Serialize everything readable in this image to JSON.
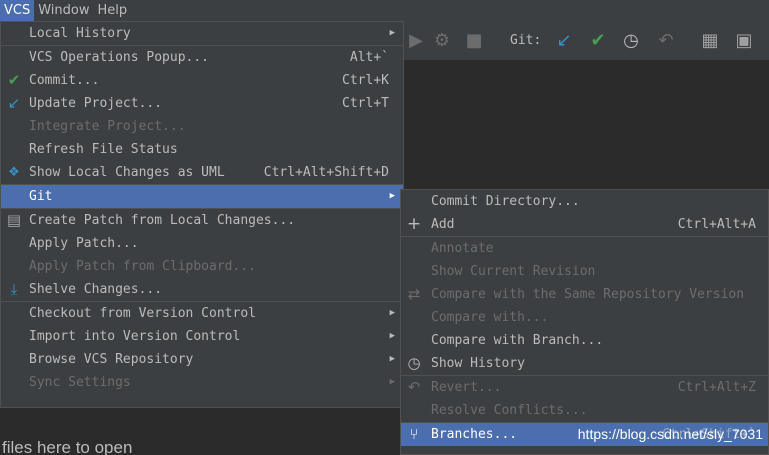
{
  "menubar": {
    "items": [
      {
        "label": "VCS"
      },
      {
        "label": "Window"
      },
      {
        "label": "Help"
      }
    ]
  },
  "toolbar": {
    "git_label": "Git:"
  },
  "editor_hint": "files here to open",
  "vcs_menu": {
    "items": [
      {
        "label": "Local History",
        "shortcut": ""
      },
      {
        "label": "VCS Operations Popup...",
        "shortcut": "Alt+`"
      },
      {
        "label": "Commit...",
        "shortcut": "Ctrl+K"
      },
      {
        "label": "Update Project...",
        "shortcut": "Ctrl+T"
      },
      {
        "label": "Integrate Project...",
        "shortcut": ""
      },
      {
        "label": "Refresh File Status",
        "shortcut": ""
      },
      {
        "label": "Show Local Changes as UML",
        "shortcut": "Ctrl+Alt+Shift+D"
      },
      {
        "label": "Git",
        "shortcut": ""
      },
      {
        "label": "Create Patch from Local Changes...",
        "shortcut": ""
      },
      {
        "label": "Apply Patch...",
        "shortcut": ""
      },
      {
        "label": "Apply Patch from Clipboard...",
        "shortcut": ""
      },
      {
        "label": "Shelve Changes...",
        "shortcut": ""
      },
      {
        "label": "Checkout from Version Control",
        "shortcut": ""
      },
      {
        "label": "Import into Version Control",
        "shortcut": ""
      },
      {
        "label": "Browse VCS Repository",
        "shortcut": ""
      },
      {
        "label": "Sync Settings",
        "shortcut": ""
      }
    ]
  },
  "git_menu": {
    "items": [
      {
        "label": "Commit Directory...",
        "shortcut": ""
      },
      {
        "label": "Add",
        "shortcut": "Ctrl+Alt+A"
      },
      {
        "label": "Annotate",
        "shortcut": ""
      },
      {
        "label": "Show Current Revision",
        "shortcut": ""
      },
      {
        "label": "Compare with the Same Repository Version",
        "shortcut": ""
      },
      {
        "label": "Compare with...",
        "shortcut": ""
      },
      {
        "label": "Compare with Branch...",
        "shortcut": ""
      },
      {
        "label": "Show History",
        "shortcut": ""
      },
      {
        "label": "Revert...",
        "shortcut": "Ctrl+Alt+Z"
      },
      {
        "label": "Resolve Conflicts...",
        "shortcut": ""
      },
      {
        "label": "Branches...",
        "shortcut": "Ctrl+Shift+`"
      }
    ]
  },
  "watermark": "https://blog.csdn.net/sly_7031",
  "colors": {
    "selection": "#4b6eaf",
    "menu_bg": "#3c3f41",
    "check_green": "#499c54",
    "update_blue": "#3592c4"
  },
  "icons": [
    "check-icon",
    "update-arrow-icon",
    "uml-icon",
    "patch-icon",
    "shelve-icon",
    "plus-icon",
    "compare-icon",
    "history-clock-icon",
    "revert-icon",
    "branch-icon",
    "run-icon",
    "debug-icon",
    "stop-icon",
    "git-update-icon",
    "git-commit-icon",
    "git-history-icon",
    "git-rollback-icon",
    "project-structure-icon",
    "terminal-icon"
  ]
}
